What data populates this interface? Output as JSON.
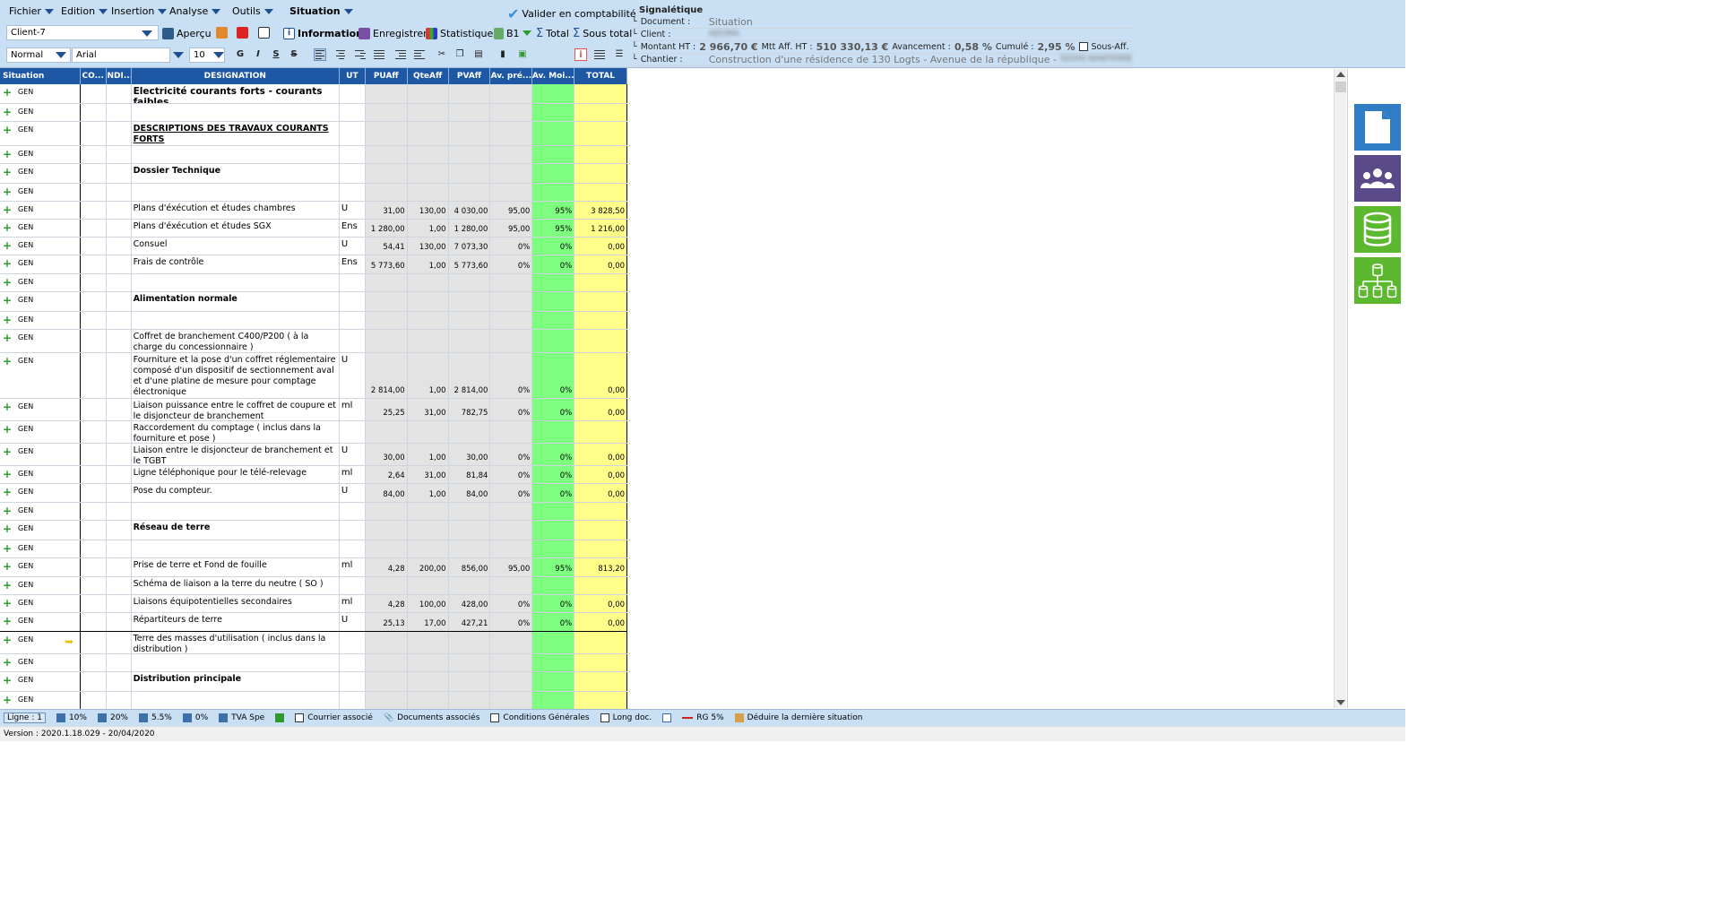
{
  "menu": {
    "fichier": "Fichier",
    "edition": "Edition",
    "insertion": "Insertion",
    "analyse": "Analyse",
    "outils": "Outils",
    "situation": "Situation"
  },
  "toolbar": {
    "client_value": "Client-7",
    "apercu": "Aperçu",
    "information": "Information",
    "enregistrer": "Enregistrer",
    "statistiques": "Statistiques",
    "b1": "B1",
    "total": "Total",
    "sous_total": "Sous total",
    "valider": "Valider en comptabilité",
    "style_value": "Normal",
    "font_value": "Arial",
    "size_value": "10",
    "bold": "G",
    "italic": "I",
    "underline": "S",
    "strike": "S"
  },
  "signaletique": {
    "title": "Signalétique",
    "document_label": "Document :",
    "document_value": "Situation",
    "client_label": "Client :",
    "client_value": "ADOMA",
    "montant_label": "Montant HT :",
    "montant_value": "2 966,70 €",
    "mtt_label": "Mtt Aff. HT :",
    "mtt_value": "510 330,13 €",
    "avancement_label": "Avancement :",
    "avancement_value": "0,58 %",
    "cumule_label": "Cumulé :",
    "cumule_value": "2,95 %",
    "sous_aff_label": "Sous-Aff.",
    "chantier_label": "Chantier :",
    "chantier_value": "Construction d'une résidence de 130 Logts - Avenue de la république -",
    "chantier_city": "92000 NANTERRE"
  },
  "columns": {
    "situation": "Situation",
    "co": "CO...",
    "indi": "INDI...",
    "designation": "DESIGNATION",
    "ut": "UT",
    "puaff": "PUAff",
    "qteaff": "QteAff",
    "pvaff": "PVAff",
    "avpre": "Av. pré...",
    "avmoi": "Av. Moi...",
    "total": "TOTAL"
  },
  "rows": [
    {
      "gen": "GEN",
      "des": "Electricité courants forts - courants faibles",
      "style": "bold-lg",
      "ut": "",
      "pu": "",
      "qte": "",
      "pv": "",
      "avp": "",
      "avm": "",
      "tot": ""
    },
    {
      "gen": "GEN",
      "des": "",
      "style": "",
      "ut": "",
      "pu": "",
      "qte": "",
      "pv": "",
      "avp": "",
      "avm": "",
      "tot": ""
    },
    {
      "gen": "GEN",
      "des": "DESCRIPTIONS DES TRAVAUX COURANTS FORTS",
      "style": "under",
      "ut": "",
      "pu": "",
      "qte": "",
      "pv": "",
      "avp": "",
      "avm": "",
      "tot": ""
    },
    {
      "gen": "GEN",
      "des": "",
      "style": "",
      "ut": "",
      "pu": "",
      "qte": "",
      "pv": "",
      "avp": "",
      "avm": "",
      "tot": ""
    },
    {
      "gen": "GEN",
      "des": "Dossier Technique",
      "style": "bold",
      "ut": "",
      "pu": "",
      "qte": "",
      "pv": "",
      "avp": "",
      "avm": "",
      "tot": ""
    },
    {
      "gen": "GEN",
      "des": "",
      "style": "",
      "ut": "",
      "pu": "",
      "qte": "",
      "pv": "",
      "avp": "",
      "avm": "",
      "tot": ""
    },
    {
      "gen": "GEN",
      "des": "Plans d'éxécution et études chambres",
      "style": "",
      "ut": "U",
      "pu": "31,00",
      "qte": "130,00",
      "pv": "4 030,00",
      "avp": "95,00",
      "avm": "95%",
      "tot": "3 828,50"
    },
    {
      "gen": "GEN",
      "des": "Plans d'éxécution et études SGX",
      "style": "",
      "ut": "Ens",
      "pu": "1 280,00",
      "qte": "1,00",
      "pv": "1 280,00",
      "avp": "95,00",
      "avm": "95%",
      "tot": "1 216,00"
    },
    {
      "gen": "GEN",
      "des": "Consuel",
      "style": "",
      "ut": "U",
      "pu": "54,41",
      "qte": "130,00",
      "pv": "7 073,30",
      "avp": "0%",
      "avm": "0%",
      "tot": "0,00"
    },
    {
      "gen": "GEN",
      "des": "Frais de contrôle",
      "style": "",
      "ut": "Ens",
      "pu": "5 773,60",
      "qte": "1,00",
      "pv": "5 773,60",
      "avp": "0%",
      "avm": "0%",
      "tot": "0,00"
    },
    {
      "gen": "GEN",
      "des": "",
      "style": "",
      "ut": "",
      "pu": "",
      "qte": "",
      "pv": "",
      "avp": "",
      "avm": "",
      "tot": ""
    },
    {
      "gen": "GEN",
      "des": "Alimentation normale",
      "style": "bold",
      "ut": "",
      "pu": "",
      "qte": "",
      "pv": "",
      "avp": "",
      "avm": "",
      "tot": ""
    },
    {
      "gen": "GEN",
      "des": "",
      "style": "",
      "ut": "",
      "pu": "",
      "qte": "",
      "pv": "",
      "avp": "",
      "avm": "",
      "tot": ""
    },
    {
      "gen": "GEN",
      "des": "Coffret de branchement C400/P200 ( à la charge du concessionnaire )",
      "style": "",
      "ut": "",
      "pu": "",
      "qte": "",
      "pv": "",
      "avp": "",
      "avm": "",
      "tot": ""
    },
    {
      "gen": "GEN",
      "des": "Fourniture et la pose d'un coffret réglementaire composé d'un dispositif de sectionnement aval et d'une platine de mesure pour comptage électronique",
      "style": "",
      "ut": "U",
      "pu": "2 814,00",
      "qte": "1,00",
      "pv": "2 814,00",
      "avp": "0%",
      "avm": "0%",
      "tot": "0,00"
    },
    {
      "gen": "GEN",
      "des": "Liaison puissance entre le coffret de coupure et le disjoncteur de branchement",
      "style": "",
      "ut": "ml",
      "pu": "25,25",
      "qte": "31,00",
      "pv": "782,75",
      "avp": "0%",
      "avm": "0%",
      "tot": "0,00"
    },
    {
      "gen": "GEN",
      "des": "Raccordement du comptage ( inclus dans la fourniture et pose )",
      "style": "",
      "ut": "",
      "pu": "",
      "qte": "",
      "pv": "",
      "avp": "",
      "avm": "",
      "tot": ""
    },
    {
      "gen": "GEN",
      "des": "Liaison entre le disjoncteur de branchement et le TGBT",
      "style": "",
      "ut": "U",
      "pu": "30,00",
      "qte": "1,00",
      "pv": "30,00",
      "avp": "0%",
      "avm": "0%",
      "tot": "0,00"
    },
    {
      "gen": "GEN",
      "des": "Ligne téléphonique pour le télé-relevage",
      "style": "",
      "ut": "ml",
      "pu": "2,64",
      "qte": "31,00",
      "pv": "81,84",
      "avp": "0%",
      "avm": "0%",
      "tot": "0,00"
    },
    {
      "gen": "GEN",
      "des": "Pose du compteur.",
      "style": "",
      "ut": "U",
      "pu": "84,00",
      "qte": "1,00",
      "pv": "84,00",
      "avp": "0%",
      "avm": "0%",
      "tot": "0,00"
    },
    {
      "gen": "GEN",
      "des": "",
      "style": "",
      "ut": "",
      "pu": "",
      "qte": "",
      "pv": "",
      "avp": "",
      "avm": "",
      "tot": ""
    },
    {
      "gen": "GEN",
      "des": "Réseau de terre",
      "style": "bold",
      "ut": "",
      "pu": "",
      "qte": "",
      "pv": "",
      "avp": "",
      "avm": "",
      "tot": ""
    },
    {
      "gen": "GEN",
      "des": "",
      "style": "",
      "ut": "",
      "pu": "",
      "qte": "",
      "pv": "",
      "avp": "",
      "avm": "",
      "tot": ""
    },
    {
      "gen": "GEN",
      "des": "Prise de terre et Fond de fouille",
      "style": "",
      "ut": "ml",
      "pu": "4,28",
      "qte": "200,00",
      "pv": "856,00",
      "avp": "95,00",
      "avm": "95%",
      "tot": "813,20"
    },
    {
      "gen": "GEN",
      "des": "Schéma de liaison a la terre du neutre ( SO )",
      "style": "",
      "ut": "",
      "pu": "",
      "qte": "",
      "pv": "",
      "avp": "",
      "avm": "",
      "tot": ""
    },
    {
      "gen": "GEN",
      "des": "Liaisons équipotentielles secondaires",
      "style": "",
      "ut": "ml",
      "pu": "4,28",
      "qte": "100,00",
      "pv": "428,00",
      "avp": "0%",
      "avm": "0%",
      "tot": "0,00"
    },
    {
      "gen": "GEN",
      "des": "Répartiteurs de terre",
      "style": "",
      "ut": "U",
      "pu": "25,13",
      "qte": "17,00",
      "pv": "427,21",
      "avp": "0%",
      "avm": "0%",
      "tot": "0,00"
    },
    {
      "gen": "GEN",
      "des": "Terre des masses d'utilisation ( inclus dans la distribution )",
      "style": "",
      "ut": "",
      "pu": "",
      "qte": "",
      "pv": "",
      "avp": "",
      "avm": "",
      "tot": ""
    },
    {
      "gen": "GEN",
      "des": "",
      "style": "",
      "ut": "",
      "pu": "",
      "qte": "",
      "pv": "",
      "avp": "",
      "avm": "",
      "tot": ""
    },
    {
      "gen": "GEN",
      "des": "Distribution principale",
      "style": "bold",
      "ut": "",
      "pu": "",
      "qte": "",
      "pv": "",
      "avp": "",
      "avm": "",
      "tot": ""
    },
    {
      "gen": "GEN",
      "des": "",
      "style": "",
      "ut": "",
      "pu": "",
      "qte": "",
      "pv": "",
      "avp": "",
      "avm": "",
      "tot": ""
    }
  ],
  "statusbar": {
    "ligne": "Ligne : 1",
    "tva10": "10%",
    "tva20": "20%",
    "tva55": "5.5%",
    "tva0": "0%",
    "tvaspe": "TVA Spe",
    "courrier": "Courrier associé",
    "documents": "Documents associés",
    "conditions": "Conditions Générales",
    "longdoc": "Long doc.",
    "rg": "RG 5%",
    "deduire": "Déduire la dernière situation"
  },
  "version": "Version : 2020.1.18.029 - 20/04/2020",
  "colors": {
    "header_blue": "#1e57a3",
    "toolbar_bg": "#c9dff3",
    "green_col": "#7fff7f",
    "yellow_col": "#ffff8a",
    "gray_col": "#e3e3e3"
  }
}
